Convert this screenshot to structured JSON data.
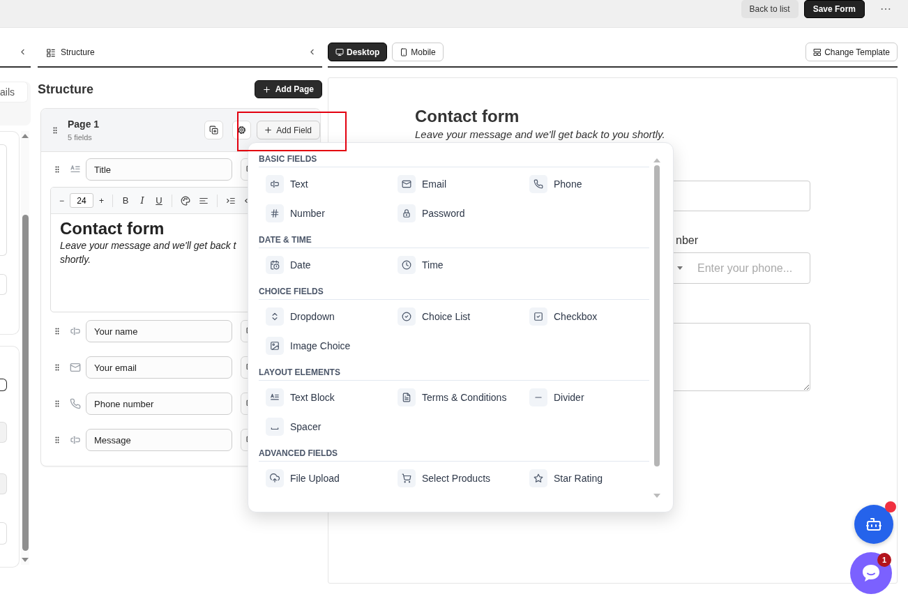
{
  "top_bar": {
    "buttons": [
      {
        "label": "Back to list",
        "kind": "secondary"
      },
      {
        "label": "Save Form",
        "kind": "primary"
      }
    ],
    "more": "⋯"
  },
  "left_panel": {
    "tab": "ails"
  },
  "structure_panel": {
    "header": "Structure",
    "heading": "Structure",
    "add_page": "Add Page",
    "pages": [
      {
        "title": "Page 1",
        "count": "5 fields",
        "add_field": "Add Field",
        "fields": [
          {
            "label": "Title",
            "kind": "text-block",
            "editor": {
              "decrease": "−",
              "size": "24",
              "increase": "+",
              "format_buttons": [
                "B",
                "I",
                "U"
              ],
              "title": "Contact form",
              "lines": [
                "Leave your message and we'll get back t",
                "shortly."
              ]
            }
          },
          {
            "label": "Your name",
            "kind": "text"
          },
          {
            "label": "Your email",
            "kind": "email"
          },
          {
            "label": "Phone number",
            "kind": "phone"
          },
          {
            "label": "Message",
            "kind": "text"
          }
        ]
      }
    ]
  },
  "preview": {
    "modes": [
      {
        "label": "Desktop",
        "kind": "desktop",
        "selected": true
      },
      {
        "label": "Mobile",
        "kind": "mobile",
        "selected": false
      }
    ],
    "change_template": "Change Template",
    "form": {
      "title": "Contact form",
      "subtitle": "Leave your message and we'll get back to you shortly.",
      "fields": [
        {
          "kind": "input"
        },
        {
          "kind": "phone",
          "label": "nber",
          "placeholder": "Enter your phone..."
        },
        {
          "kind": "textarea"
        }
      ]
    }
  },
  "add_field_menu": {
    "sections": [
      {
        "title": "BASIC FIELDS",
        "items": [
          {
            "label": "Text",
            "kind": "text"
          },
          {
            "label": "Email",
            "kind": "email"
          },
          {
            "label": "Phone",
            "kind": "phone"
          },
          {
            "label": "Number",
            "kind": "number"
          },
          {
            "label": "Password",
            "kind": "password"
          }
        ]
      },
      {
        "title": "DATE & TIME",
        "items": [
          {
            "label": "Date",
            "kind": "date"
          },
          {
            "label": "Time",
            "kind": "time"
          }
        ]
      },
      {
        "title": "CHOICE FIELDS",
        "items": [
          {
            "label": "Dropdown",
            "kind": "dropdown"
          },
          {
            "label": "Choice List",
            "kind": "choice-list"
          },
          {
            "label": "Checkbox",
            "kind": "checkbox"
          },
          {
            "label": "Image Choice",
            "kind": "image-choice"
          }
        ]
      },
      {
        "title": "LAYOUT ELEMENTS",
        "items": [
          {
            "label": "Text Block",
            "kind": "text-block"
          },
          {
            "label": "Terms & Conditions",
            "kind": "terms"
          },
          {
            "label": "Divider",
            "kind": "divider"
          },
          {
            "label": "Spacer",
            "kind": "spacer"
          }
        ]
      },
      {
        "title": "ADVANCED FIELDS",
        "items": [
          {
            "label": "File Upload",
            "kind": "file-upload"
          },
          {
            "label": "Select Products",
            "kind": "products"
          },
          {
            "label": "Star Rating",
            "kind": "star-rating"
          }
        ]
      }
    ]
  },
  "chat": {
    "badge": "1"
  }
}
